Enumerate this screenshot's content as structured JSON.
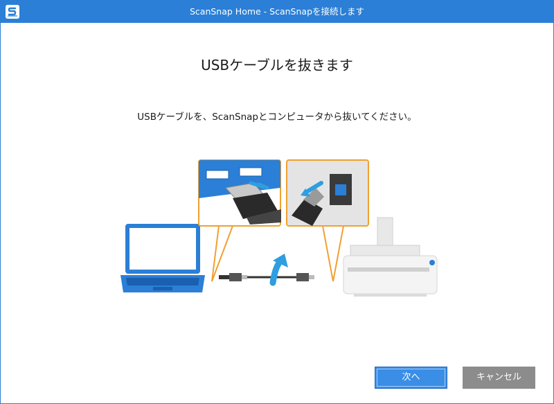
{
  "window": {
    "title": "ScanSnap Home - ScanSnapを接続します",
    "icon": "scansnap-app-icon"
  },
  "main": {
    "heading": "USBケーブルを抜きます",
    "instruction": "USBケーブルを、ScanSnapとコンピュータから抜いてください。"
  },
  "illustration": {
    "icons": [
      "laptop-icon",
      "usb-cable-icon",
      "scanner-icon",
      "arrow-up-icon",
      "computer-usb-port-callout",
      "scanner-usb-port-callout"
    ],
    "colors": {
      "accent_blue": "#2b7fd6",
      "callout_orange": "#f0a030",
      "arrow_blue": "#2e9ee0"
    }
  },
  "buttons": {
    "next_label": "次へ",
    "cancel_label": "キャンセル"
  },
  "colors": {
    "titlebar": "#2b7fd6",
    "primary_button": "#3a8ee6",
    "secondary_button": "#8c8c8c"
  }
}
